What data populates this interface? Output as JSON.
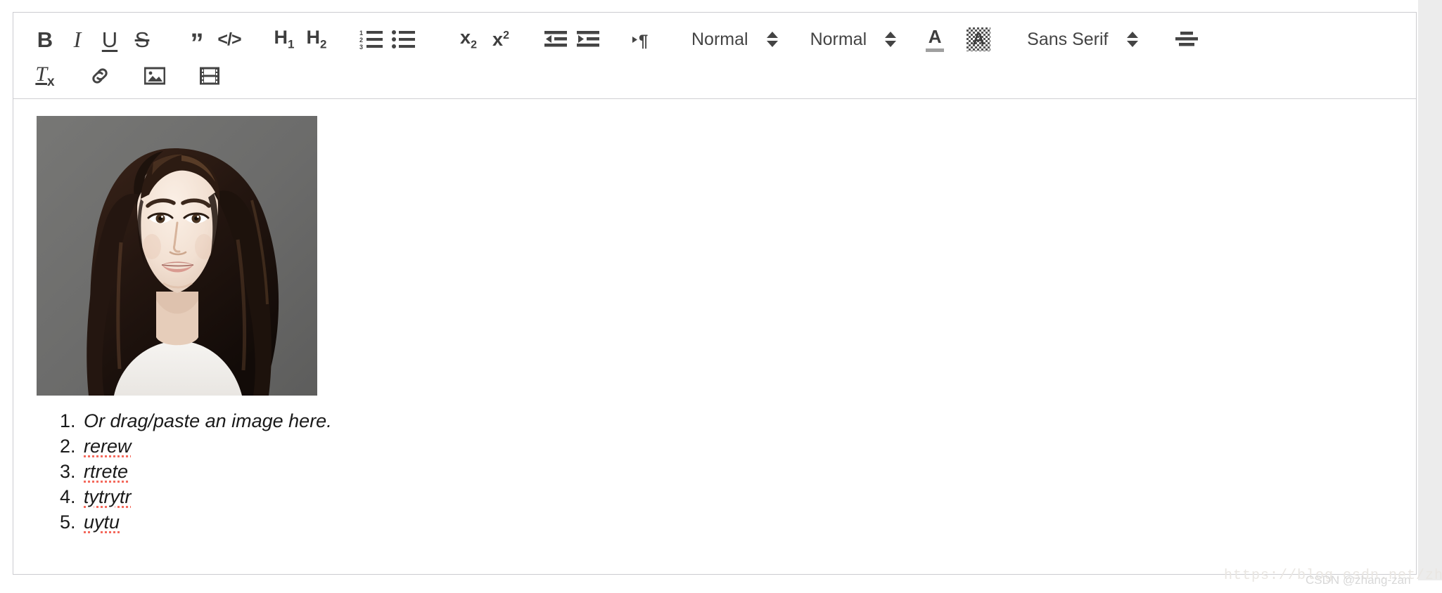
{
  "editor": {
    "toolbar": {
      "row1": [
        {
          "name": "bold-button",
          "label": "B",
          "kind": "glyph",
          "style": "bold"
        },
        {
          "name": "italic-button",
          "label": "I",
          "kind": "glyph",
          "style": "italic"
        },
        {
          "name": "underline-button",
          "label": "U",
          "kind": "glyph",
          "style": "underline"
        },
        {
          "name": "strikethrough-button",
          "label": "S",
          "kind": "glyph",
          "style": "strike"
        },
        {
          "name": "blockquote-button",
          "label": "”",
          "kind": "glyph",
          "style": "quote"
        },
        {
          "name": "code-block-button",
          "label": "</>",
          "kind": "glyph",
          "style": "code"
        },
        {
          "name": "heading-1-button",
          "label": "H1",
          "kind": "glyph",
          "style": "h1"
        },
        {
          "name": "heading-2-button",
          "label": "H2",
          "kind": "glyph",
          "style": "h2"
        },
        {
          "name": "ordered-list-button",
          "label": "",
          "kind": "icon",
          "icon": "ordered-list-icon"
        },
        {
          "name": "bullet-list-button",
          "label": "",
          "kind": "icon",
          "icon": "bullet-list-icon"
        },
        {
          "name": "subscript-button",
          "label": "x2",
          "kind": "glyph",
          "style": "sub"
        },
        {
          "name": "superscript-button",
          "label": "x2",
          "kind": "glyph",
          "style": "sup"
        },
        {
          "name": "outdent-button",
          "label": "",
          "kind": "icon",
          "icon": "outdent-icon"
        },
        {
          "name": "indent-button",
          "label": "",
          "kind": "icon",
          "icon": "indent-icon"
        },
        {
          "name": "text-direction-button",
          "label": "",
          "kind": "icon",
          "icon": "text-direction-icon"
        }
      ],
      "row2": [
        {
          "name": "clear-formatting-button",
          "label": "Tx",
          "kind": "glyph",
          "style": "tx"
        },
        {
          "name": "insert-link-button",
          "label": "",
          "kind": "icon",
          "icon": "link-icon"
        },
        {
          "name": "insert-image-button",
          "label": "",
          "kind": "icon",
          "icon": "image-icon"
        },
        {
          "name": "insert-video-button",
          "label": "",
          "kind": "icon",
          "icon": "video-icon"
        }
      ],
      "dropdowns": {
        "size": {
          "label": "Normal",
          "name": "size-dropdown"
        },
        "header": {
          "label": "Normal",
          "name": "header-dropdown"
        },
        "font": {
          "label": "Sans Serif",
          "name": "font-dropdown"
        }
      },
      "color_buttons": {
        "text_color": {
          "letter": "A",
          "name": "text-color-button",
          "color": "#a0a0a0"
        },
        "background_color": {
          "letter": "A",
          "name": "background-color-button"
        }
      },
      "align": {
        "name": "align-center-button",
        "icon": "align-center-icon"
      },
      "glyph_labels": {
        "bold": "B",
        "italic": "I",
        "underline": "U",
        "strike": "S",
        "quote": "”",
        "code": "</>",
        "h1_base": "H",
        "h1_sub": "1",
        "h2_base": "H",
        "h2_sub": "2",
        "x_base": "x",
        "sub_num": "2",
        "sup_num": "2",
        "t_base": "T",
        "t_sub": "x"
      }
    },
    "content": {
      "image": {
        "name": "inserted-portrait-image",
        "alt": "portrait photo of a woman with long dark hair on gray background"
      },
      "list_items": [
        {
          "text": "Or drag/paste an image here.",
          "misspelled": false
        },
        {
          "text": "rerew",
          "misspelled": true
        },
        {
          "text": "rtrete",
          "misspelled": true
        },
        {
          "text": "tytrytr",
          "misspelled": true
        },
        {
          "text": "uytu",
          "misspelled": true
        }
      ]
    }
  },
  "watermarks": {
    "url": "https://blog.csdn.net/zhangzan",
    "attribution": "CSDN @zhang-zan"
  },
  "colors": {
    "border": "#ccccd0",
    "icon": "#444444",
    "spellcheck": "#f4695c",
    "image_bg": "#6b6b6a",
    "gutter": "#ececec"
  }
}
